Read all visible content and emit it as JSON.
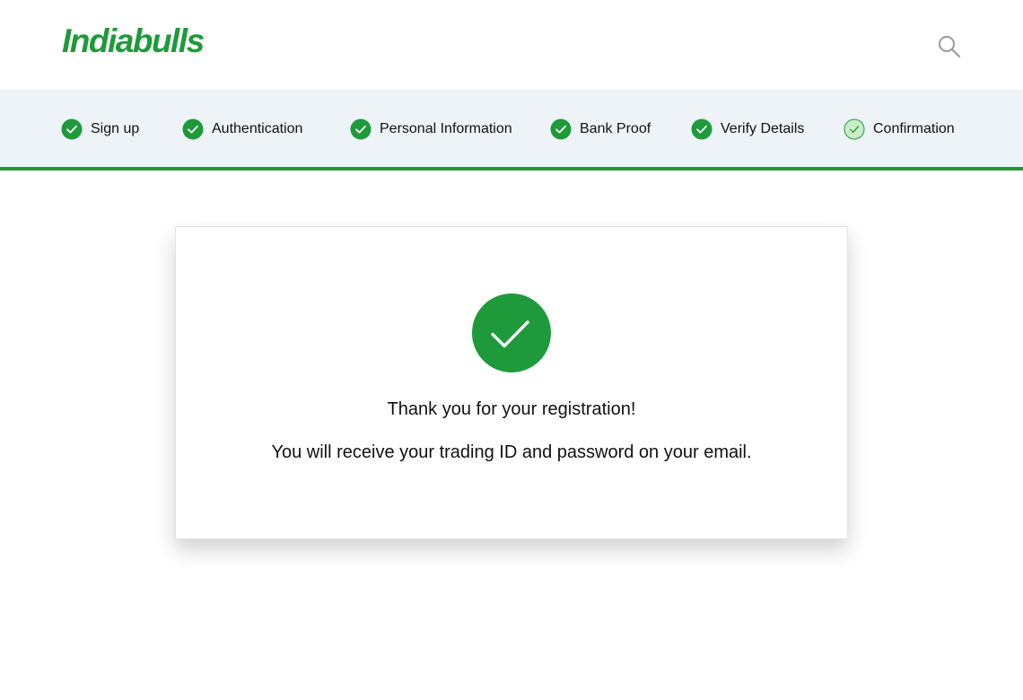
{
  "header": {
    "logo_text": "Indiabulls",
    "search_icon": "search-icon"
  },
  "steps": [
    {
      "label": "Sign up",
      "status": "completed"
    },
    {
      "label": "Authentication",
      "status": "completed"
    },
    {
      "label": "Personal Information",
      "status": "completed"
    },
    {
      "label": "Bank Proof",
      "status": "completed"
    },
    {
      "label": "Verify Details",
      "status": "completed"
    },
    {
      "label": "Confirmation",
      "status": "current"
    }
  ],
  "confirmation": {
    "icon": "check-circle-icon",
    "title": "Thank you for your registration!",
    "message": "You will receive your trading ID and password on your email."
  },
  "colors": {
    "brand": "#1e9a3a",
    "step_completed": "#1e9a3a",
    "step_current_fill": "#c9ecc9",
    "steps_bar_bg": "#eef3f8"
  }
}
